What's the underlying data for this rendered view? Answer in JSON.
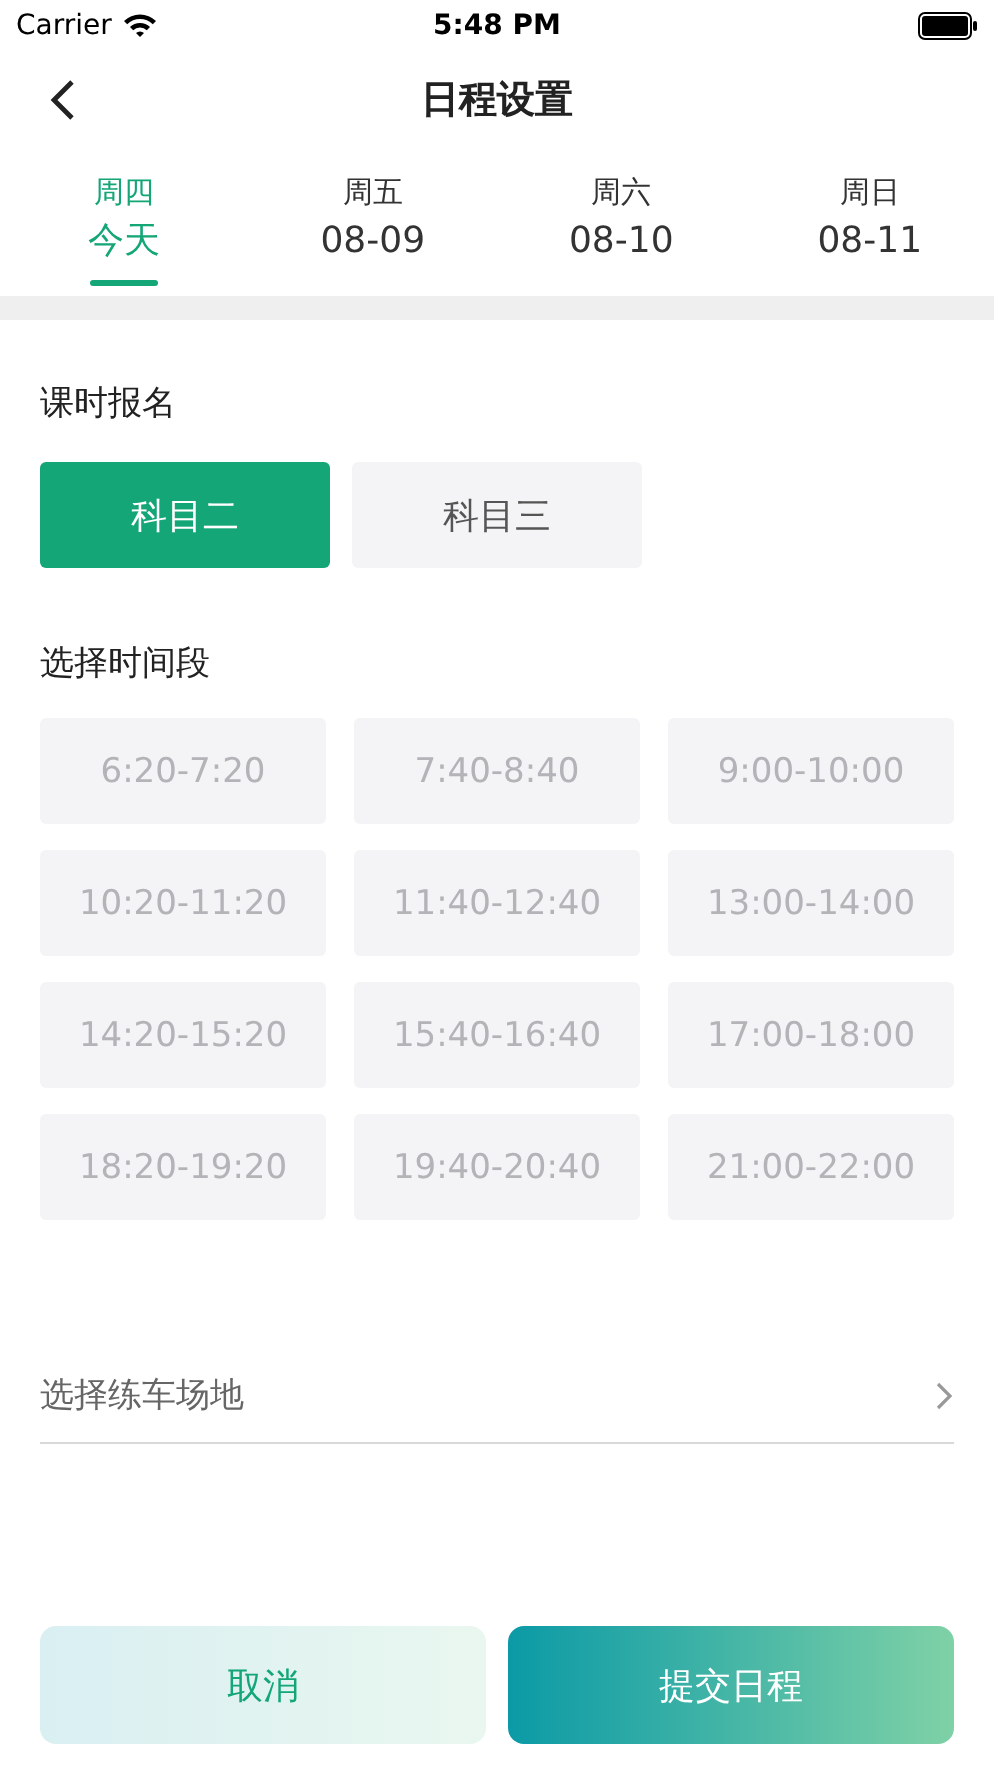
{
  "status_bar": {
    "carrier": "Carrier",
    "time": "5:48 PM"
  },
  "nav": {
    "title": "日程设置"
  },
  "day_tabs": [
    {
      "weekday": "周四",
      "date": "今天",
      "selected": true
    },
    {
      "weekday": "周五",
      "date": "08-09",
      "selected": false
    },
    {
      "weekday": "周六",
      "date": "08-10",
      "selected": false
    },
    {
      "weekday": "周日",
      "date": "08-11",
      "selected": false
    }
  ],
  "subject_section": {
    "label": "课时报名",
    "options": [
      {
        "label": "科目二",
        "selected": true
      },
      {
        "label": "科目三",
        "selected": false
      }
    ]
  },
  "time_section": {
    "label": "选择时间段",
    "slots": [
      {
        "label": "6:20-7:20",
        "disabled": true
      },
      {
        "label": "7:40-8:40",
        "disabled": true
      },
      {
        "label": "9:00-10:00",
        "disabled": true
      },
      {
        "label": "10:20-11:20",
        "disabled": true
      },
      {
        "label": "11:40-12:40",
        "disabled": true
      },
      {
        "label": "13:00-14:00",
        "disabled": true
      },
      {
        "label": "14:20-15:20",
        "disabled": true
      },
      {
        "label": "15:40-16:40",
        "disabled": true
      },
      {
        "label": "17:00-18:00",
        "disabled": true
      },
      {
        "label": "18:20-19:20",
        "disabled": true
      },
      {
        "label": "19:40-20:40",
        "disabled": true
      },
      {
        "label": "21:00-22:00",
        "disabled": true
      }
    ]
  },
  "venue": {
    "placeholder": "选择练车场地"
  },
  "buttons": {
    "cancel": "取消",
    "submit": "提交日程"
  }
}
